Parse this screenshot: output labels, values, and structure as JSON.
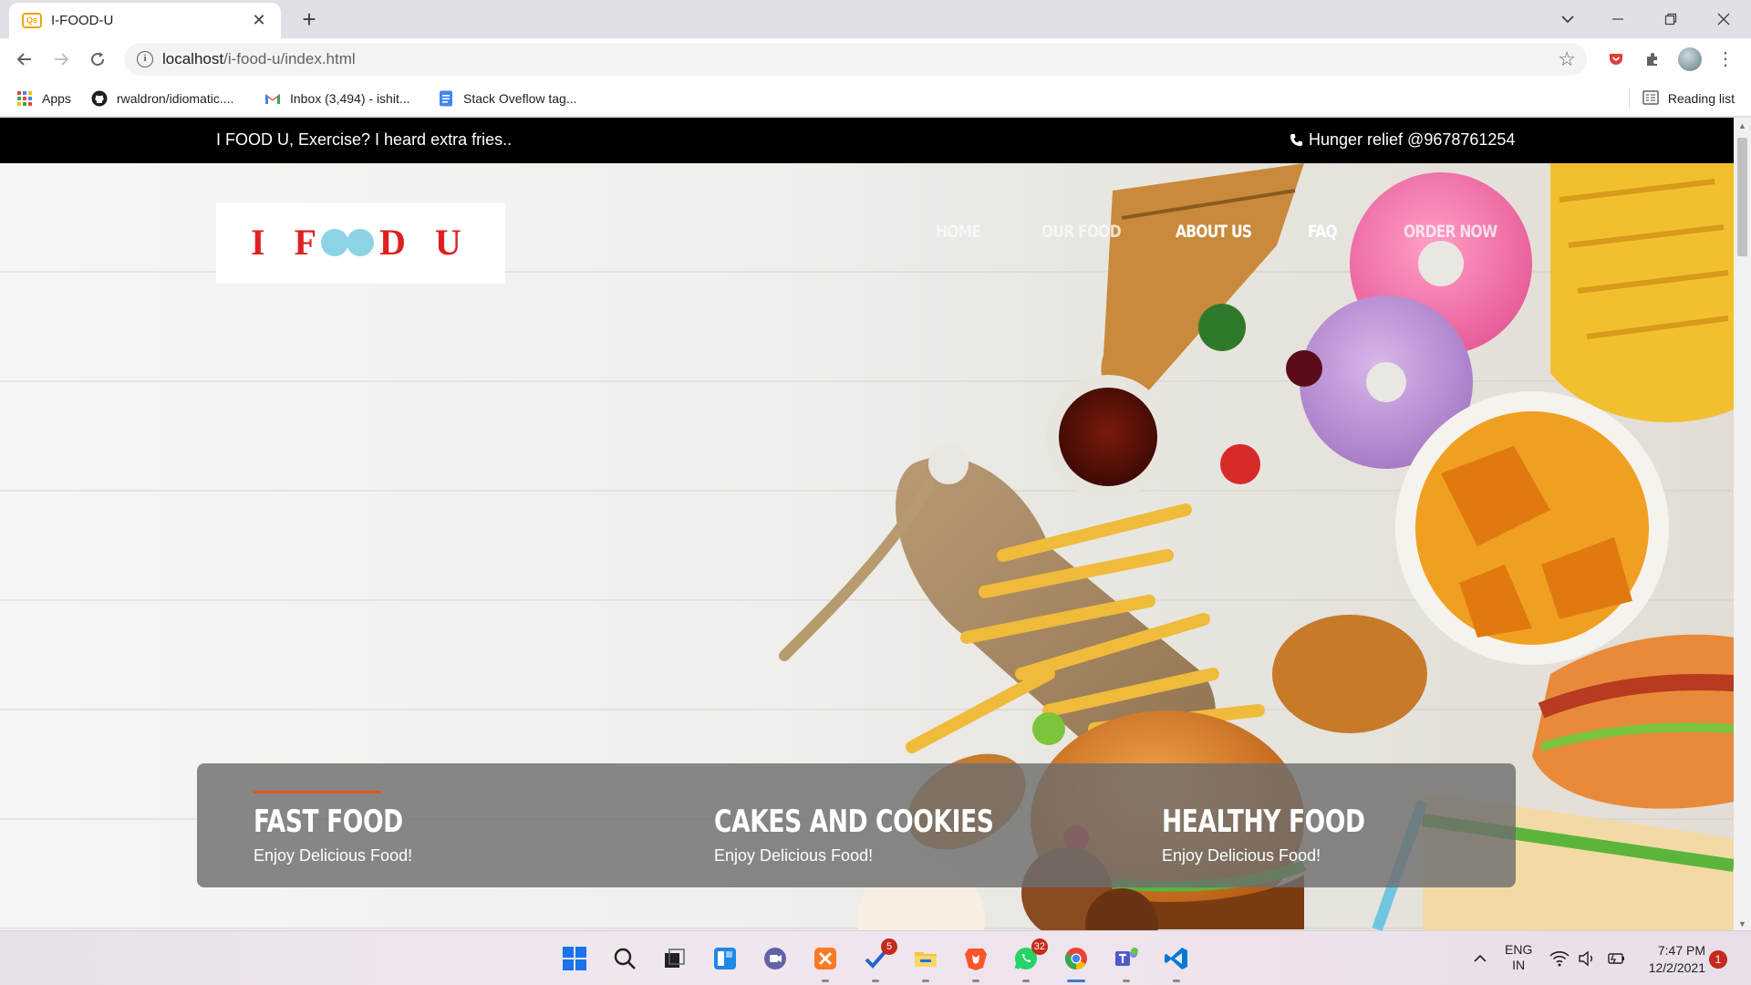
{
  "browser": {
    "tab_title": "I-FOOD-U",
    "tab_favicon_text": "Qs",
    "url_host": "localhost",
    "url_path": "/i-food-u/index.html",
    "bookmarks": [
      {
        "label": "Apps",
        "icon": "apps-grid-icon"
      },
      {
        "label": "rwaldron/idiomatic....",
        "icon": "github-icon"
      },
      {
        "label": "Inbox (3,494) - ishit...",
        "icon": "gmail-icon"
      },
      {
        "label": "Stack Oveflow tag...",
        "icon": "docs-icon"
      }
    ],
    "reading_list": "Reading list"
  },
  "site": {
    "topbar": {
      "tagline": "I FOOD U, Exercise? I heard extra fries..",
      "phone": "Hunger relief @9678761254"
    },
    "logo": {
      "letters": [
        "I",
        "F",
        "D",
        "U"
      ]
    },
    "nav": [
      {
        "label": "HOME"
      },
      {
        "label": "OUR FOOD"
      },
      {
        "label": "ABOUT US"
      },
      {
        "label": "FAQ"
      },
      {
        "label": "ORDER NOW"
      }
    ],
    "cards": [
      {
        "title": "FAST FOOD",
        "subtitle": "Enjoy Delicious Food!"
      },
      {
        "title": "CAKES AND COOKIES",
        "subtitle": "Enjoy Delicious Food!"
      },
      {
        "title": "HEALTHY FOOD",
        "subtitle": "Enjoy Delicious Food!"
      }
    ],
    "accent_color": "#e8541e",
    "logo_color": "#e02020"
  },
  "taskbar": {
    "badges": {
      "todo": "5",
      "whatsapp": "32"
    },
    "lang_line1": "ENG",
    "lang_line2": "IN",
    "time": "7:47 PM",
    "date": "12/2/2021",
    "notifications": "1"
  }
}
